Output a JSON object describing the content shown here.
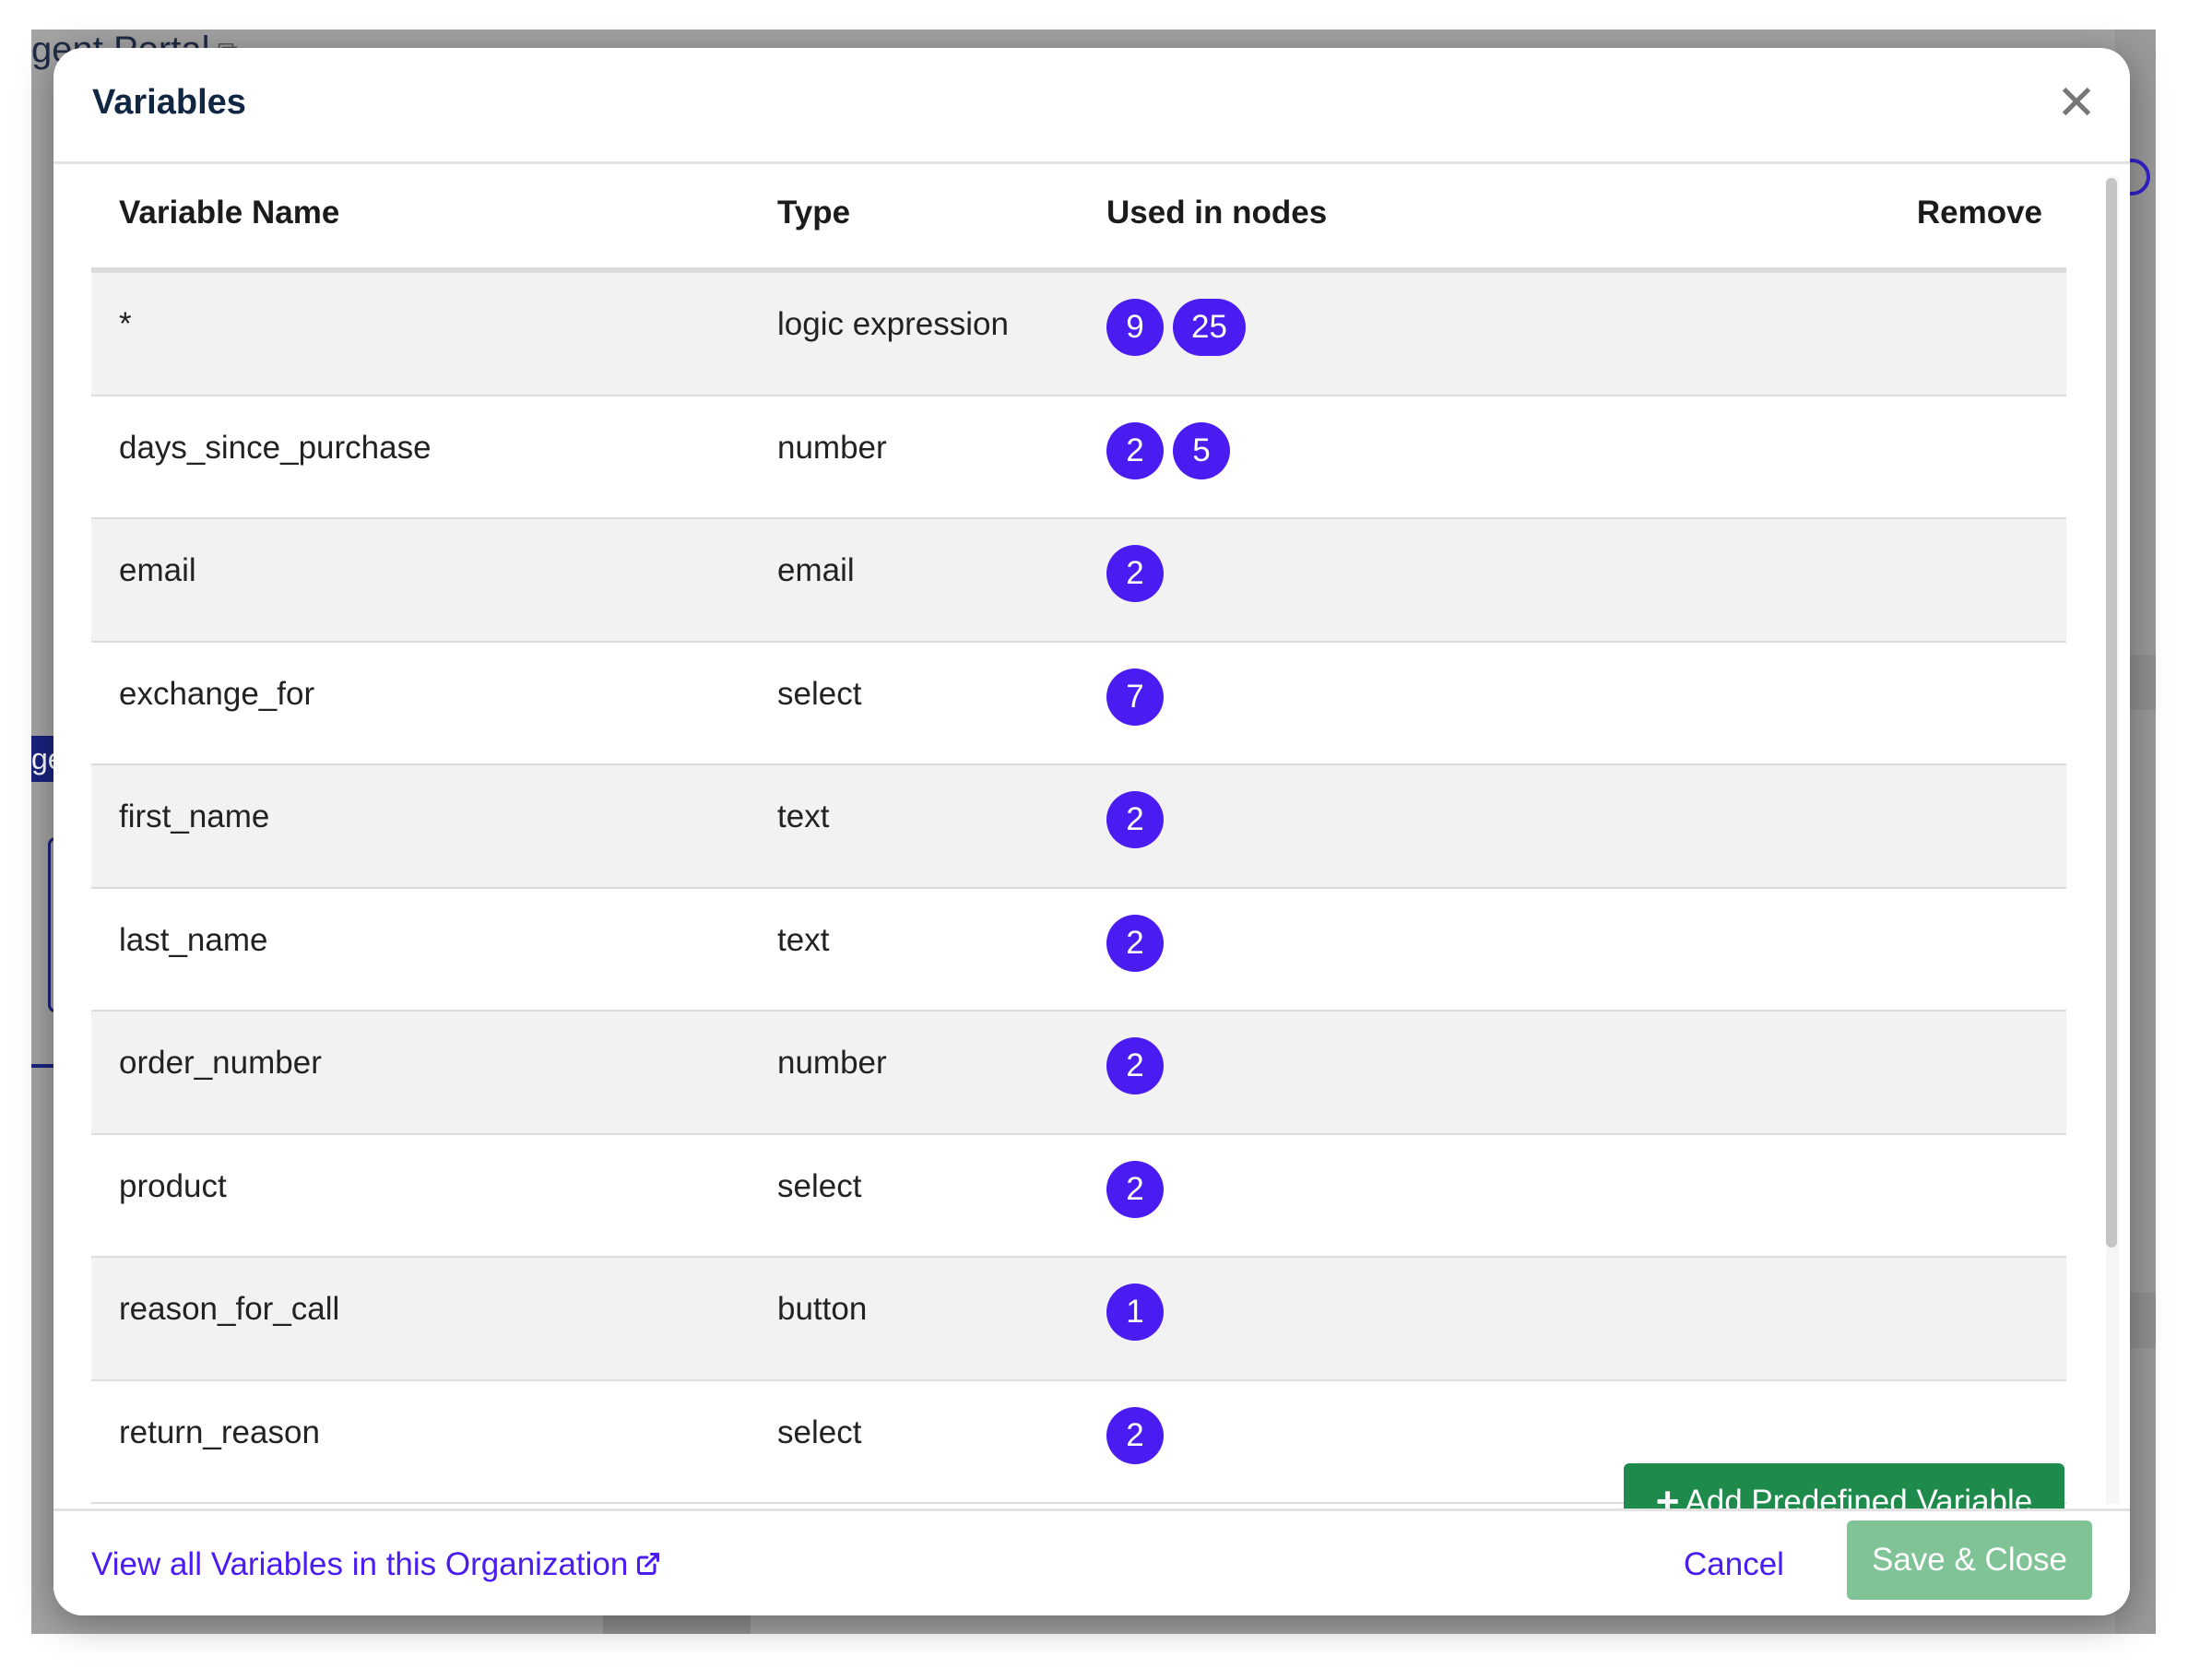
{
  "background": {
    "portal_title": "gent Portal",
    "tab_fragment": "ge"
  },
  "modal": {
    "title": "Variables",
    "close_symbol": "✕",
    "columns": {
      "name": "Variable Name",
      "type": "Type",
      "nodes": "Used in nodes",
      "remove": "Remove"
    },
    "rows": [
      {
        "name": "*",
        "type": "logic expression",
        "nodes": [
          "9",
          "25"
        ]
      },
      {
        "name": "days_since_purchase",
        "type": "number",
        "nodes": [
          "2",
          "5"
        ]
      },
      {
        "name": "email",
        "type": "email",
        "nodes": [
          "2"
        ]
      },
      {
        "name": "exchange_for",
        "type": "select",
        "nodes": [
          "7"
        ]
      },
      {
        "name": "first_name",
        "type": "text",
        "nodes": [
          "2"
        ]
      },
      {
        "name": "last_name",
        "type": "text",
        "nodes": [
          "2"
        ]
      },
      {
        "name": "order_number",
        "type": "number",
        "nodes": [
          "2"
        ]
      },
      {
        "name": "product",
        "type": "select",
        "nodes": [
          "2"
        ]
      },
      {
        "name": "reason_for_call",
        "type": "button",
        "nodes": [
          "1"
        ]
      },
      {
        "name": "return_reason",
        "type": "select",
        "nodes": [
          "2"
        ]
      }
    ],
    "add_button_label": "Add Predefined Variable",
    "footer": {
      "view_all_link": "View all Variables in this Organization",
      "cancel_label": "Cancel",
      "save_label": "Save & Close"
    }
  },
  "colors": {
    "badge": "#4a1cf2",
    "link": "#4a1cf2",
    "add_button": "#1e8a4c",
    "save_button_disabled": "#7fc397",
    "title": "#0f2742"
  }
}
